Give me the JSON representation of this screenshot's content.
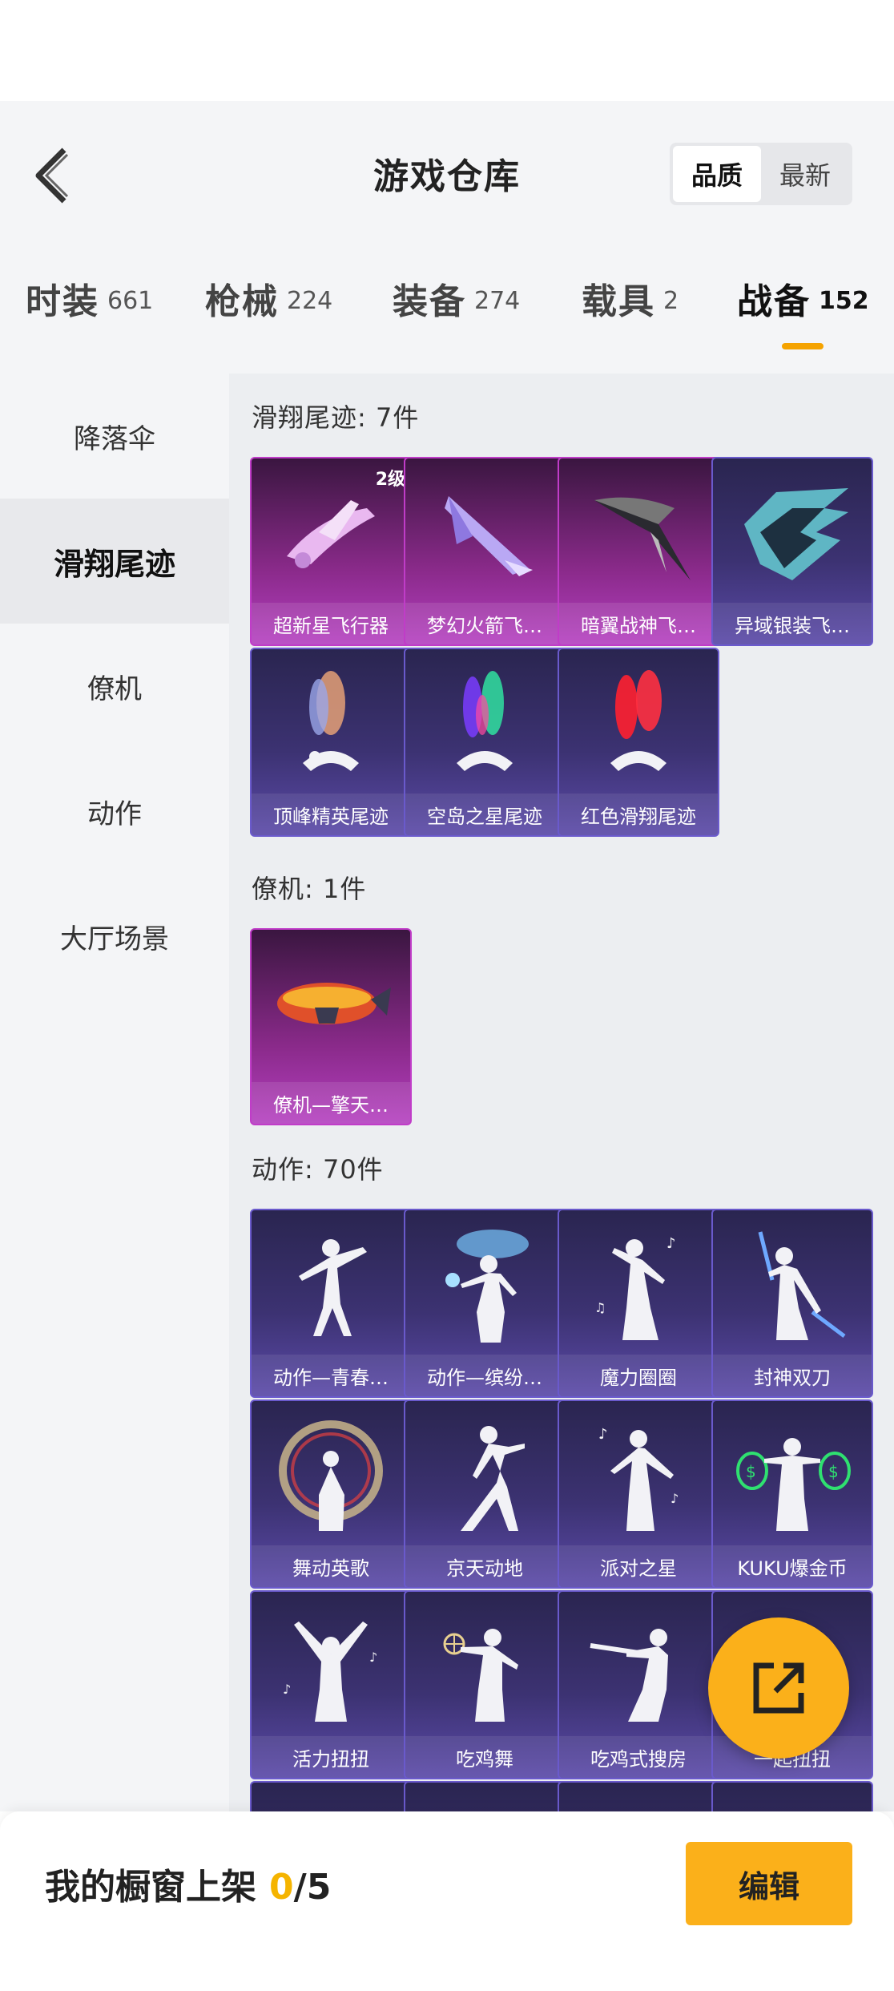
{
  "header": {
    "title": "游戏仓库",
    "sort_options": [
      {
        "label": "品质",
        "active": true
      },
      {
        "label": "最新",
        "active": false
      }
    ]
  },
  "tabs": [
    {
      "label": "时装",
      "count": "661",
      "active": false
    },
    {
      "label": "枪械",
      "count": "224",
      "active": false
    },
    {
      "label": "装备",
      "count": "274",
      "active": false
    },
    {
      "label": "载具",
      "count": "2",
      "active": false
    },
    {
      "label": "战备",
      "count": "152",
      "active": true
    }
  ],
  "sidebar": {
    "items": [
      {
        "label": "降落伞",
        "active": false
      },
      {
        "label": "滑翔尾迹",
        "active": true
      },
      {
        "label": "僚机",
        "active": false
      },
      {
        "label": "动作",
        "active": false
      },
      {
        "label": "大厅场景",
        "active": false
      }
    ]
  },
  "sections": [
    {
      "title": "滑翔尾迹: 7件",
      "items": [
        {
          "name": "超新星飞行器",
          "level": "2级",
          "rarity": "pink",
          "icon": "aircraft-icon"
        },
        {
          "name": "梦幻火箭飞…",
          "rarity": "pink",
          "icon": "rocket-glider-icon"
        },
        {
          "name": "暗翼战神飞…",
          "rarity": "pink",
          "icon": "dark-wing-icon"
        },
        {
          "name": "异域银装飞…",
          "rarity": "purple",
          "icon": "silver-wing-icon"
        },
        {
          "name": "顶峰精英尾迹",
          "rarity": "purple",
          "icon": "smoke-trail-icon"
        },
        {
          "name": "空岛之星尾迹",
          "rarity": "purple",
          "icon": "rainbow-trail-icon"
        },
        {
          "name": "红色滑翔尾迹",
          "rarity": "purple",
          "icon": "red-trail-icon"
        }
      ]
    },
    {
      "title": "僚机: 1件",
      "items": [
        {
          "name": "僚机—擎天…",
          "rarity": "pink",
          "icon": "airship-icon"
        }
      ]
    },
    {
      "title": "动作: 70件",
      "items": [
        {
          "name": "动作—青春…",
          "rarity": "purple",
          "icon": "dance-pose-icon"
        },
        {
          "name": "动作—缤纷…",
          "rarity": "purple",
          "icon": "cloud-pose-icon"
        },
        {
          "name": "魔力圈圈",
          "rarity": "purple",
          "icon": "music-pose-icon"
        },
        {
          "name": "封神双刀",
          "rarity": "purple",
          "icon": "blade-pose-icon"
        },
        {
          "name": "舞动英歌",
          "rarity": "purple",
          "icon": "ring-pose-icon"
        },
        {
          "name": "京天动地",
          "rarity": "purple",
          "icon": "kick-pose-icon"
        },
        {
          "name": "派对之星",
          "rarity": "purple",
          "icon": "party-pose-icon"
        },
        {
          "name": "KUKU爆金币",
          "rarity": "purple",
          "icon": "money-bag-pose-icon"
        },
        {
          "name": "活力扭扭",
          "rarity": "purple",
          "icon": "arms-up-pose-icon"
        },
        {
          "name": "吃鸡舞",
          "rarity": "purple",
          "icon": "target-pose-icon"
        },
        {
          "name": "吃鸡式搜房",
          "rarity": "purple",
          "icon": "rifle-pose-icon"
        },
        {
          "name": "一起扭扭",
          "rarity": "purple",
          "icon": "twist-pose-icon"
        }
      ]
    }
  ],
  "fab": {
    "icon": "share-export-icon"
  },
  "footer": {
    "label": "我的橱窗上架",
    "count": "0",
    "total": "/5",
    "edit_label": "编辑"
  },
  "colors": {
    "accent": "#fbb01a",
    "rarity_pink": "#b43fc0",
    "rarity_purple": "#5b4aa8"
  }
}
